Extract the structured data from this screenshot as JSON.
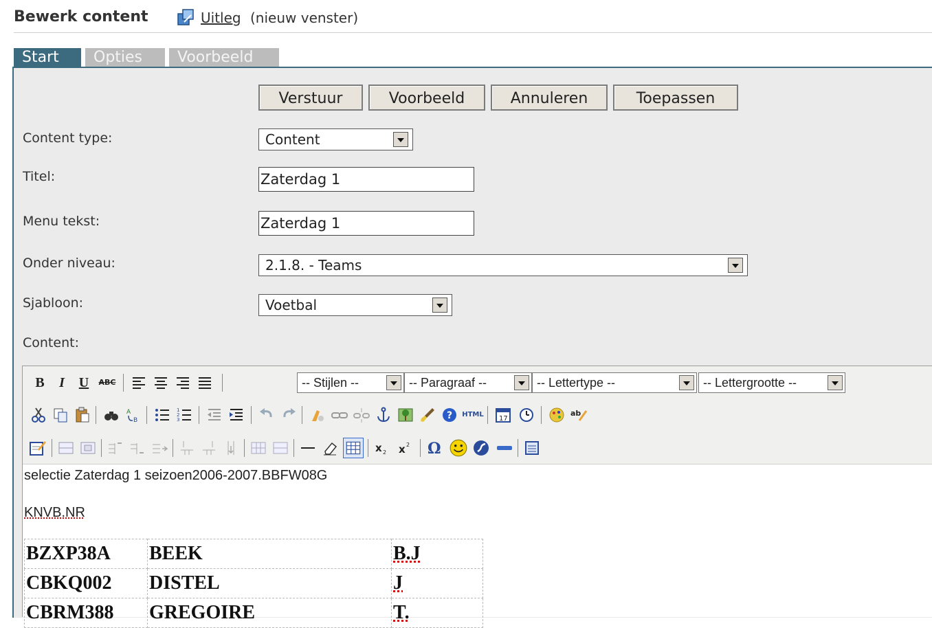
{
  "header": {
    "title": "Bewerk content",
    "help_link": "Uitleg",
    "help_note": "(nieuw venster)"
  },
  "tabs": [
    {
      "label": "Start"
    },
    {
      "label": "Opties"
    },
    {
      "label": "Voorbeeld"
    }
  ],
  "buttons": {
    "send": "Verstuur",
    "preview": "Voorbeeld",
    "cancel": "Annuleren",
    "apply": "Toepassen"
  },
  "form": {
    "content_type": {
      "label": "Content type:",
      "value": "Content"
    },
    "title": {
      "label": "Titel:",
      "value": "Zaterdag 1"
    },
    "menu_text": {
      "label": "Menu tekst:",
      "value": "Zaterdag 1"
    },
    "sub_level": {
      "label": "Onder niveau:",
      "value": "2.1.8. - Teams"
    },
    "template": {
      "label": "Sjabloon:",
      "value": "Voetbal"
    },
    "content": {
      "label": "Content:"
    }
  },
  "toolbar": {
    "styles": "-- Stijlen --",
    "paragraph": "-- Paragraaf --",
    "font": "-- Lettertype --",
    "font_size": "-- Lettergrootte --",
    "bold": "B",
    "italic": "I",
    "underline": "U",
    "strike": "ABC",
    "html": "HTML"
  },
  "editor": {
    "line1": "selectie Zaterdag 1 seizoen2006-2007.BBFW08G",
    "line2": "KNVB.NR",
    "rows": [
      {
        "id": "BZXP38A",
        "name": "BEEK",
        "initials": "B.J"
      },
      {
        "id": "CBKQ002",
        "name": "DISTEL",
        "initials": "J"
      },
      {
        "id": "CBRM388",
        "name": "GREGOIRE",
        "initials": "T."
      }
    ]
  }
}
